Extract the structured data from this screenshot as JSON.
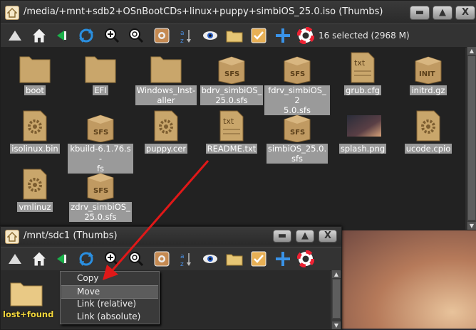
{
  "window1": {
    "title": "/media/+mnt+sdb2+OSnBootCDs+linux+puppy+simbiOS_25.0.iso (Thumbs)",
    "selection_status": "16 selected (2968 M)",
    "items": [
      {
        "label": "boot",
        "icon": "folder-icon"
      },
      {
        "label": "EFI",
        "icon": "folder-icon"
      },
      {
        "label": "Windows_Installer",
        "icon": "folder-icon"
      },
      {
        "label": "bdrv_simbiOS_25.0.sfs",
        "icon": "sfs-package-icon"
      },
      {
        "label": "fdrv_simbiOS_25.0.sfs",
        "icon": "sfs-package-icon"
      },
      {
        "label": "grub.cfg",
        "icon": "text-file-icon"
      },
      {
        "label": "initrd.gz",
        "icon": "init-package-icon"
      },
      {
        "label": "isolinux.bin",
        "icon": "binary-file-icon"
      },
      {
        "label": "kbuild-6.1.76.s-fs",
        "icon": "sfs-package-icon"
      },
      {
        "label": "puppy.cer",
        "icon": "binary-file-icon"
      },
      {
        "label": "README.txt",
        "icon": "text-file-icon"
      },
      {
        "label": "simbiOS_25.0.sfs",
        "icon": "sfs-package-icon"
      },
      {
        "label": "splash.png",
        "icon": "image-thumbnail"
      },
      {
        "label": "ucode.cpio",
        "icon": "binary-file-icon"
      },
      {
        "label": "vmlinuz",
        "icon": "binary-file-icon"
      },
      {
        "label": "zdrv_simbiOS_25.0.sfs",
        "icon": "sfs-package-icon"
      }
    ],
    "item_labels_wrapped": {
      "windows": [
        "Windows_Inst-",
        "aller"
      ],
      "bdrv": [
        "bdrv_simbiOS_",
        "25.0.sfs"
      ],
      "fdrv": [
        "fdrv_simbiOS_2",
        "5.0.sfs"
      ],
      "kbuild": [
        "kbuild-6.1.76.s-",
        "fs"
      ],
      "simbios": [
        "simbiOS_25.0.",
        "sfs"
      ],
      "zdrv": [
        "zdrv_simbiOS_",
        "25.0.sfs"
      ]
    }
  },
  "window2": {
    "title": "/mnt/sdc1 (Thumbs)",
    "items": [
      {
        "label": "lost+found",
        "icon": "folder-icon"
      }
    ]
  },
  "context_menu": {
    "items": [
      "Copy",
      "Move",
      "Link (relative)",
      "Link (absolute)"
    ],
    "highlighted": "Move"
  },
  "window_buttons": {
    "minimize": "▬",
    "maximize": "▲",
    "close": "X"
  },
  "icon_labels": {
    "sfs": "SFS",
    "txt": "txt",
    "init": "INIT"
  },
  "colors": {
    "accent_folder": "#c9a66b",
    "highlight_label": "#9a9a9a",
    "arrow": "#e01818",
    "lostfound_label": "#f2d63c"
  }
}
